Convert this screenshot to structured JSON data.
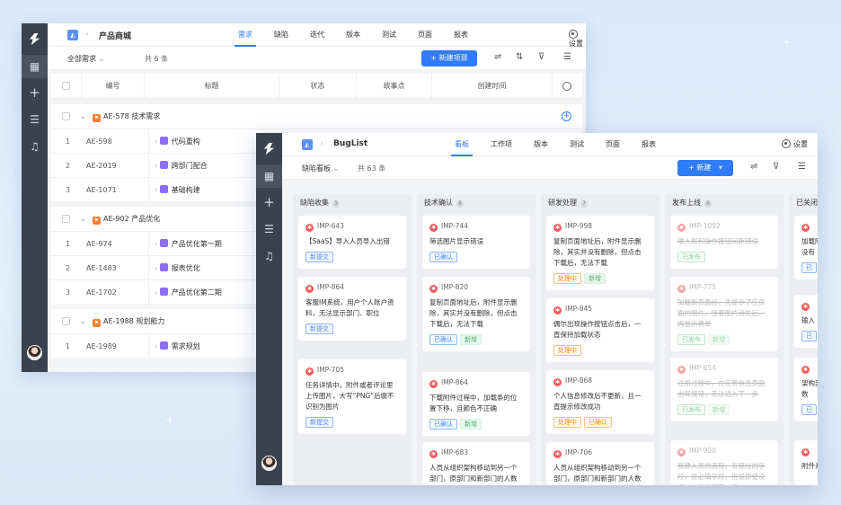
{
  "back_window": {
    "project": "产品商城",
    "tabs": [
      {
        "label": "需求",
        "active": true
      },
      {
        "label": "缺陷"
      },
      {
        "label": "迭代"
      },
      {
        "label": "版本"
      },
      {
        "label": "测试"
      },
      {
        "label": "页面"
      },
      {
        "label": "报表"
      }
    ],
    "settings_label": "设置",
    "filter_label": "全部需求",
    "count_label": "共 6 条",
    "new_button": "+ 新建项目",
    "columns": [
      "编号",
      "标题",
      "状态",
      "故事点",
      "创建时间"
    ],
    "groups": [
      {
        "title": "AE-578 技术需求",
        "rows": [
          {
            "n": "1",
            "id": "AE-598",
            "title": "代码重构"
          },
          {
            "n": "2",
            "id": "AE-2019",
            "title": "跨部门配合"
          },
          {
            "n": "3",
            "id": "AE-1071",
            "title": "基础构建"
          }
        ]
      },
      {
        "title": "AE-902 产品优化",
        "rows": [
          {
            "n": "1",
            "id": "AE-974",
            "title": "产品优化第一期"
          },
          {
            "n": "2",
            "id": "AE-1483",
            "title": "报表优化"
          },
          {
            "n": "3",
            "id": "AE-1702",
            "title": "产品优化第二期"
          }
        ]
      },
      {
        "title": "AE-1988 规划能力",
        "rows": [
          {
            "n": "1",
            "id": "AE-1989",
            "title": "需求规划"
          }
        ]
      }
    ]
  },
  "front_window": {
    "project": "BugList",
    "tabs": [
      {
        "label": "看板",
        "active": true
      },
      {
        "label": "工作项"
      },
      {
        "label": "版本"
      },
      {
        "label": "测试"
      },
      {
        "label": "页面"
      },
      {
        "label": "报表"
      }
    ],
    "settings_label": "设置",
    "filter_label": "缺陷看板",
    "count_label": "共 63 条",
    "new_button": "+ 新建",
    "columns": [
      {
        "title": "缺陷收集",
        "count": "3",
        "cards": [
          {
            "id": "IMP-643",
            "title": "【SaaS】导入人员导入出错",
            "tags": [
              [
                "新提交",
                "blue"
              ]
            ]
          },
          {
            "id": "IMP-864",
            "title": "客服IM系统，用户个人账户资料，无法显示部门、职位",
            "tags": [
              [
                "新提交",
                "blue"
              ]
            ]
          },
          {
            "id": "IMP-705",
            "title": "任务详情中，附件或者评论里上传图片，大写“PNG”后缀不识别为图片",
            "tags": [
              [
                "新提交",
                "blue"
              ]
            ]
          }
        ]
      },
      {
        "title": "技术确认",
        "count": "8",
        "cards": [
          {
            "id": "IMP-744",
            "title": "筛选图片显示错误",
            "tags": [
              [
                "已确认",
                "blue"
              ]
            ]
          },
          {
            "id": "IMP-820",
            "title": "复制页面地址后，附件显示删除，其实并没有删除，但点击下载后，无法下载",
            "tags": [
              [
                "已确认",
                "blue"
              ],
              [
                "新增",
                "green"
              ]
            ]
          },
          {
            "id": "IMP-864",
            "title": "下载附件过程中，加载条的位置下移，且颜色不正确",
            "tags": [
              [
                "已确认",
                "blue"
              ],
              [
                "新增",
                "green"
              ]
            ]
          },
          {
            "id": "IMP-683",
            "title": "人员从组织架构移动到另一个部门，原部门和新部门的人数都没有更新",
            "tags": []
          }
        ]
      },
      {
        "title": "研发处理",
        "count": "7",
        "cards": [
          {
            "id": "IMP-998",
            "title": "复制页面地址后，附件显示删除，其实并没有删除，但点击下载后，无法下载",
            "tags": [
              [
                "处理中",
                "orange"
              ],
              [
                "新增",
                "green"
              ]
            ]
          },
          {
            "id": "IMP-845",
            "title": "偶尔出现操作按钮点击后，一直保持加载状态",
            "tags": [
              [
                "处理中",
                "orange"
              ]
            ]
          },
          {
            "id": "IMP-868",
            "title": "个人信息修改后不更新，且一直提示修改成功",
            "tags": [
              [
                "处理中",
                "orange"
              ],
              [
                "已确认",
                "orange"
              ]
            ]
          },
          {
            "id": "IMP-706",
            "title": "人员从组织架构移动到另一个部门，原部门和新部门的人数",
            "tags": []
          }
        ]
      },
      {
        "title": "发布上线",
        "count": "6",
        "cards": [
          {
            "id": "IMP-1092",
            "title": "输入框和操作按钮间距错误",
            "tags": [
              [
                "已发布",
                "greenline"
              ]
            ]
          },
          {
            "id": "IMP-775",
            "title": "加载新页面后，先显示了空页面的图片，接着图片消失后，再显示表单",
            "tags": [
              [
                "已发布",
                "greenline"
              ],
              [
                "新增",
                "green"
              ]
            ]
          },
          {
            "id": "IMP-654",
            "title": "注册过程中，在完善信息页面出现报错，无法进入下一步",
            "tags": [
              [
                "已发布",
                "greenline"
              ],
              [
                "新增",
                "green"
              ]
            ]
          },
          {
            "id": "IMP-920",
            "title": "新建人员的流程，有部分的字段，是必填字段，但是即使没填，也能进行下一步",
            "tags": []
          }
        ]
      },
      {
        "title": "已关闭",
        "count": "",
        "cards": [
          {
            "id": "",
            "title": "加载附件并没有",
            "tags": [
              [
                "已",
                "blue"
              ]
            ]
          },
          {
            "id": "",
            "title": "输入",
            "tags": [
              [
                "已",
                "blue"
              ]
            ]
          },
          {
            "id": "",
            "title": "架构部门人数",
            "tags": [
              [
                "已",
                "blue"
              ]
            ]
          },
          {
            "id": "",
            "title": "附件并没",
            "tags": []
          }
        ]
      }
    ]
  },
  "colors": {
    "accent": "#2f7cf6",
    "rail": "#3a4250",
    "bug": "#f25c5c",
    "story": "#8c6df5",
    "flag": "#fa7d34"
  }
}
